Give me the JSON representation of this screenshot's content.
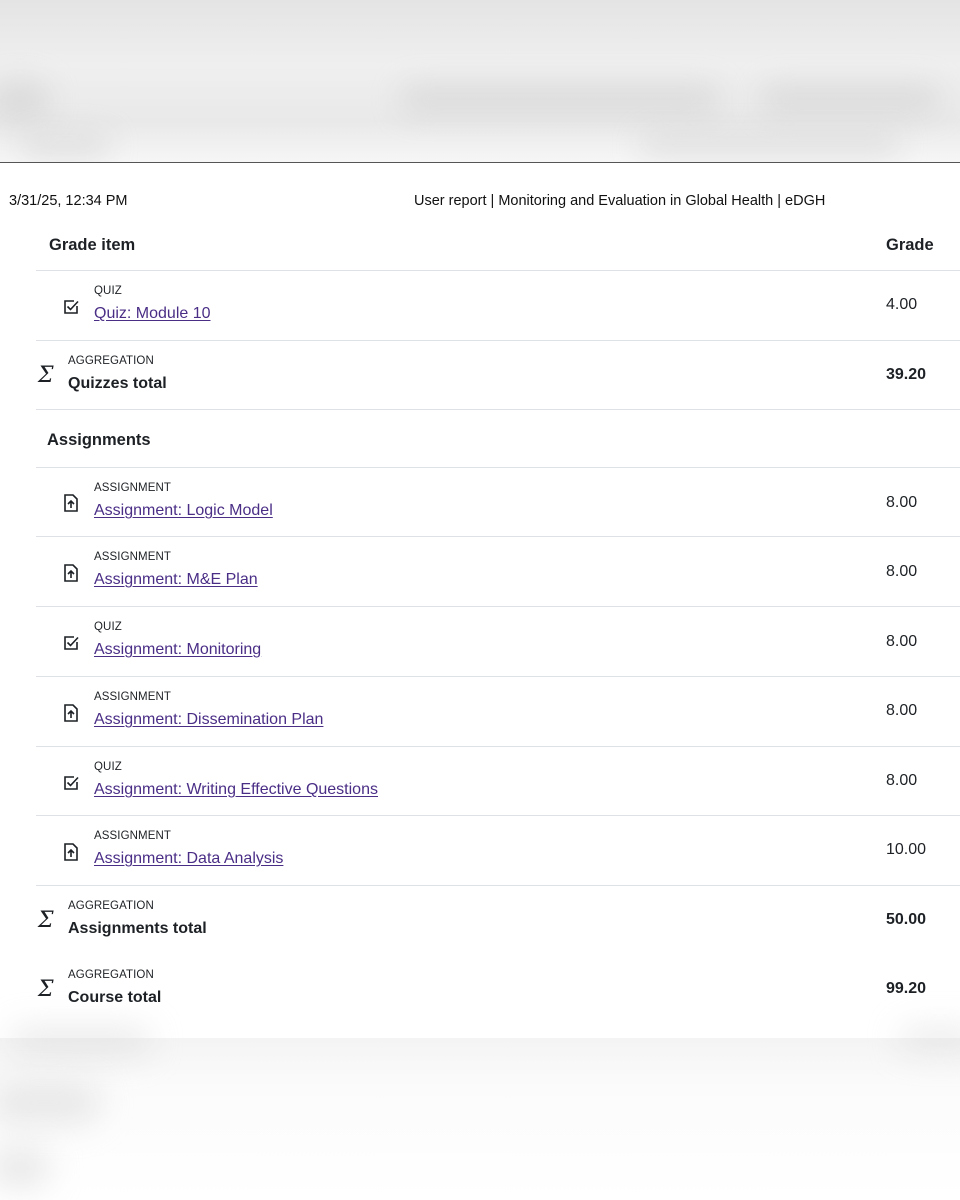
{
  "print_header": {
    "date": "3/31/25, 12:34 PM",
    "title": "User report | Monitoring and Evaluation in Global Health | eDGH"
  },
  "table": {
    "col_item": "Grade item",
    "col_grade": "Grade"
  },
  "rows": [
    {
      "type": "QUIZ",
      "name": "Quiz: Module 10",
      "grade": "4.00",
      "icon": "quiz-check-icon"
    },
    {
      "type": "AGGREGATION",
      "name": "Quizzes total",
      "grade": "39.20",
      "icon": "sigma-icon"
    }
  ],
  "category": {
    "name": "Assignments"
  },
  "assignments": [
    {
      "type": "ASSIGNMENT",
      "name": "Assignment: Logic Model",
      "grade": "8.00",
      "icon": "assignment-upload-icon"
    },
    {
      "type": "ASSIGNMENT",
      "name": "Assignment: M&E Plan",
      "grade": "8.00",
      "icon": "assignment-upload-icon"
    },
    {
      "type": "QUIZ",
      "name": "Assignment: Monitoring",
      "grade": "8.00",
      "icon": "quiz-check-icon"
    },
    {
      "type": "ASSIGNMENT",
      "name": "Assignment: Dissemination Plan",
      "grade": "8.00",
      "icon": "assignment-upload-icon"
    },
    {
      "type": "QUIZ",
      "name": "Assignment: Writing Effective Questions",
      "grade": "8.00",
      "icon": "quiz-check-icon"
    },
    {
      "type": "ASSIGNMENT",
      "name": "Assignment: Data Analysis",
      "grade": "10.00",
      "icon": "assignment-upload-icon"
    }
  ],
  "totals": [
    {
      "type": "AGGREGATION",
      "name": "Assignments total",
      "grade": "50.00",
      "icon": "sigma-icon"
    },
    {
      "type": "AGGREGATION",
      "name": "Course total",
      "grade": "99.20",
      "icon": "sigma-icon"
    }
  ],
  "colors": {
    "link": "#4a2e86",
    "text": "#1d2125",
    "rule": "#dee2e6",
    "sigma": "#6a737b"
  }
}
